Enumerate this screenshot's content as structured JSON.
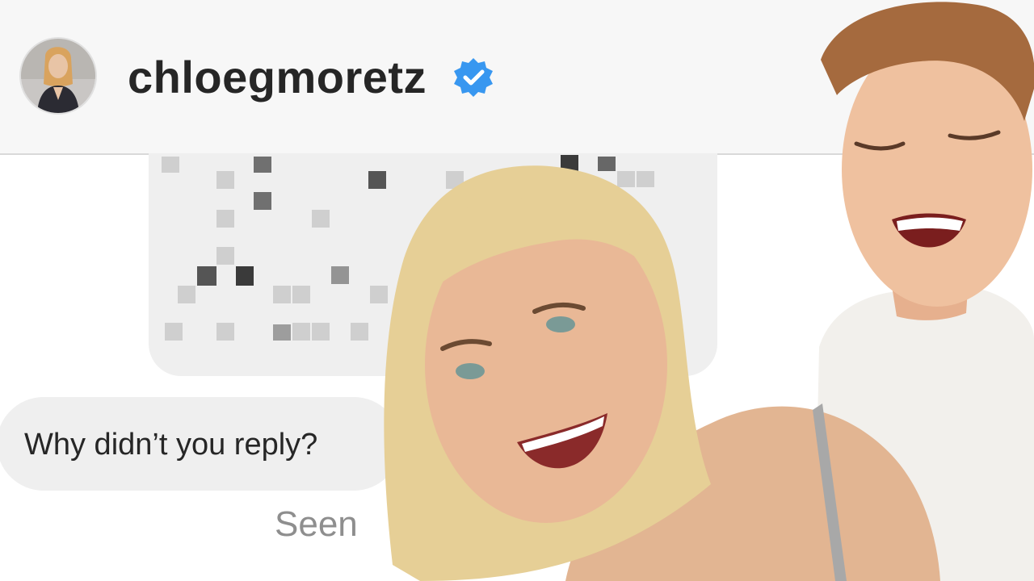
{
  "chat_header": {
    "username": "chloegmoretz",
    "verified_icon": "verified-badge-icon",
    "accent": "#3897f0"
  },
  "messages": {
    "reply_text": "Why didn’t you reply?",
    "status": "Seen"
  }
}
